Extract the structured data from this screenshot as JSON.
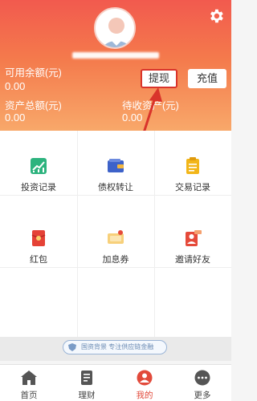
{
  "header": {
    "available_label": "可用余额(元)",
    "available_value": "0.00",
    "total_label": "资产总额(元)",
    "total_value": "0.00",
    "pending_label": "待收资产(元)",
    "pending_value": "0.00",
    "withdraw_label": "提现",
    "recharge_label": "充值"
  },
  "grid": {
    "items": [
      {
        "label": "投资记录",
        "icon": "chart-icon",
        "color": "#2db37e"
      },
      {
        "label": "债权转让",
        "icon": "wallet-icon",
        "color": "#3d62c9"
      },
      {
        "label": "交易记录",
        "icon": "clipboard-icon",
        "color": "#f2b619"
      },
      {
        "label": "红包",
        "icon": "red-packet-icon",
        "color": "#e54236"
      },
      {
        "label": "加息券",
        "icon": "coupon-icon",
        "color": "#f2b640"
      },
      {
        "label": "邀请好友",
        "icon": "invite-icon",
        "color": "#e54a3a"
      }
    ]
  },
  "banner": {
    "text": "国资背景 专注供应链金融"
  },
  "tabbar": {
    "items": [
      {
        "label": "首页",
        "icon": "home-icon"
      },
      {
        "label": "理财",
        "icon": "finance-icon"
      },
      {
        "label": "我的",
        "icon": "user-icon"
      },
      {
        "label": "更多",
        "icon": "more-icon"
      }
    ],
    "active_color": "#e24a3b"
  },
  "accent_color": "#f25a4e",
  "annotation_color": "#d9342b"
}
